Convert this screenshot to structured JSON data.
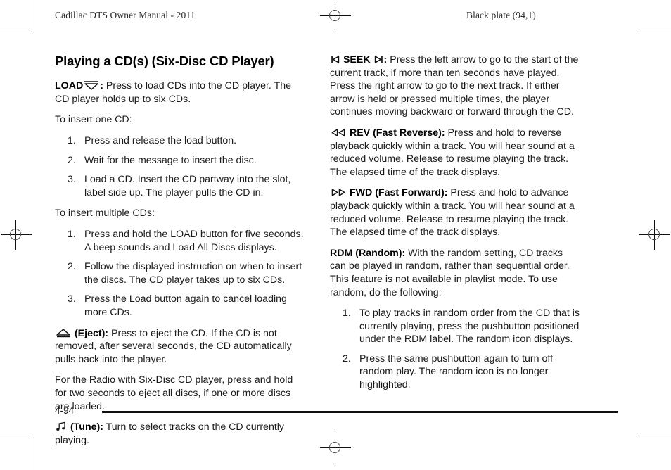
{
  "header": {
    "left": "Cadillac DTS Owner Manual - 2011",
    "right": "Black plate (94,1)"
  },
  "footer": {
    "page_number": "4-94"
  },
  "left_column": {
    "title": "Playing a CD(s) (Six-Disc CD Player)",
    "load": {
      "label": "LOAD",
      "icon": "load-triangle-down-icon",
      "colon": ":",
      "text": "Press to load CDs into the CD player. The CD player holds up to six CDs."
    },
    "insert_one_intro": "To insert one CD:",
    "insert_one_steps": [
      {
        "num": "1.",
        "text": "Press and release the load button."
      },
      {
        "num": "2.",
        "text": "Wait for the message to insert the disc."
      },
      {
        "num": "3.",
        "text": "Load a CD. Insert the CD partway into the slot, label side up. The player pulls the CD in."
      }
    ],
    "insert_multiple_intro": "To insert multiple CDs:",
    "insert_multiple_steps": [
      {
        "num": "1.",
        "text": "Press and hold the LOAD button for five seconds. A beep sounds and Load All Discs displays."
      },
      {
        "num": "2.",
        "text": "Follow the displayed instruction on when to insert the discs. The CD player takes up to six CDs."
      },
      {
        "num": "3.",
        "text": "Press the Load button again to cancel loading more CDs."
      }
    ],
    "eject": {
      "icon": "eject-triangle-up-icon",
      "label": "(Eject):",
      "text": "Press to eject the CD. If the CD is not removed, after several seconds, the CD automatically pulls back into the player."
    },
    "eject_all": "For the Radio with Six-Disc CD player, press and hold for two seconds to eject all discs, if one or more discs are loaded.",
    "tune": {
      "icon": "music-note-icon",
      "label": "(Tune):",
      "text": "Turn to select tracks on the CD currently playing."
    }
  },
  "right_column": {
    "seek": {
      "icon_left": "seek-previous-icon",
      "label": "SEEK",
      "icon_right": "seek-next-icon",
      "colon": ":",
      "text": "Press the left arrow to go to the start of the current track, if more than ten seconds have played. Press the right arrow to go to the next track. If either arrow is held or pressed multiple times, the player continues moving backward or forward through the CD."
    },
    "rev": {
      "icon": "rewind-double-left-icon",
      "label": "REV (Fast Reverse):",
      "text": "Press and hold to reverse playback quickly within a track. You will hear sound at a reduced volume. Release to resume playing the track. The elapsed time of the track displays."
    },
    "fwd": {
      "icon": "fast-forward-double-right-icon",
      "label": "FWD (Fast Forward):",
      "text": "Press and hold to advance playback quickly within a track. You will hear sound at a reduced volume. Release to resume playing the track. The elapsed time of the track displays."
    },
    "rdm": {
      "label": "RDM (Random):",
      "text": "With the random setting, CD tracks can be played in random, rather than sequential order. This feature is not available in playlist mode. To use random, do the following:"
    },
    "rdm_steps": [
      {
        "num": "1.",
        "text": "To play tracks in random order from the CD that is currently playing, press the pushbutton positioned under the RDM label. The random icon displays."
      },
      {
        "num": "2.",
        "text": "Press the same pushbutton again to turn off random play. The random icon is no longer highlighted."
      }
    ]
  }
}
